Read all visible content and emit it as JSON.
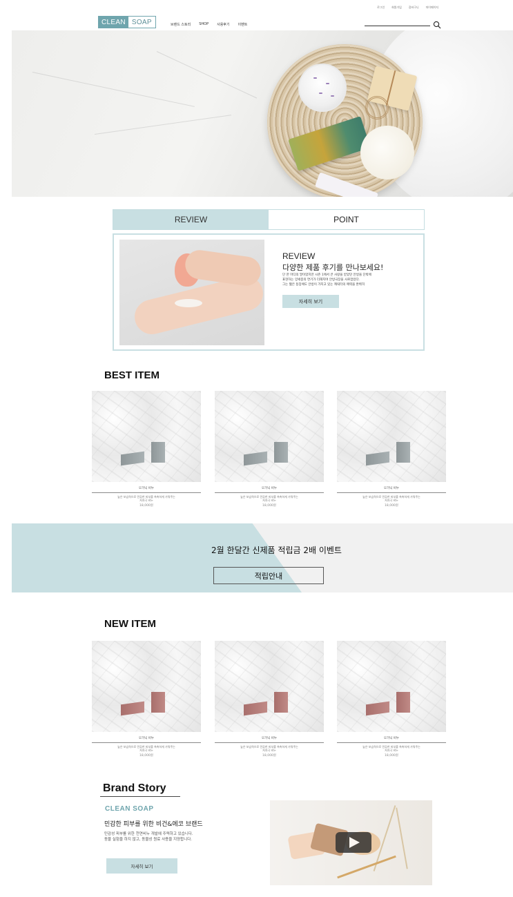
{
  "util_links": [
    "로그인",
    "회원가입",
    "장바구니",
    "마이페이지"
  ],
  "logo": {
    "part1": "CLEAN",
    "part2": "SOAP"
  },
  "nav": [
    "브랜드 스토리",
    "SHOP",
    "사용후기",
    "이벤트"
  ],
  "tabs": {
    "review": "REVIEW",
    "point": "POINT"
  },
  "review": {
    "title": "REVIEW",
    "subtitle": "다양한 제품 후기를 만나보세요!",
    "desc_lines": [
      "단 한 마디의 말이었지만 시즌 1에서 큰 사랑을 받았던 안방을 단박에",
      "표현하는 양세종의 연기가 더해지며 안방극장을 사로잡았다.",
      "그는 짧은 등장에도 안방이 가지고 있는 캐릭터의 매력을 완벽히"
    ],
    "button": "자세히 보기"
  },
  "best": {
    "title": "BEST ITEM",
    "items": [
      {
        "name": "오가닉 비누",
        "desc1": "높은 보습력으로 민감한 피부를 촉촉하게 가꿔주는",
        "desc2": "저자극 비누",
        "price": "18,000원"
      },
      {
        "name": "오가닉 비누",
        "desc1": "높은 보습력으로 민감한 피부를 촉촉하게 가꿔주는",
        "desc2": "저자극 비누",
        "price": "18,000원"
      },
      {
        "name": "오가닉 비누",
        "desc1": "높은 보습력으로 민감한 피부를 촉촉하게 가꿔주는",
        "desc2": "저자극 비누",
        "price": "18,000원"
      }
    ]
  },
  "event": {
    "title": "2월 한달간 신제품 적립금 2배 이벤트",
    "button": "적립안내"
  },
  "new": {
    "title": "NEW ITEM",
    "items": [
      {
        "name": "오가닉 비누",
        "desc1": "높은 보습력으로 민감한 피부를 촉촉하게 가꿔주는",
        "desc2": "저자극 비누",
        "price": "18,000원"
      },
      {
        "name": "오가닉 비누",
        "desc1": "높은 보습력으로 민감한 피부를 촉촉하게 가꿔주는",
        "desc2": "저자극 비누",
        "price": "18,000원"
      },
      {
        "name": "오가닉 비누",
        "desc1": "높은 보습력으로 민감한 피부를 촉촉하게 가꿔주는",
        "desc2": "저자극 비누",
        "price": "18,000원"
      }
    ]
  },
  "brand": {
    "title": "Brand Story",
    "logo": "CLEAN  SOAP",
    "subtitle": "민감한 피부를 위한 비건&에코 브랜드",
    "desc_lines": [
      "민감성 피부를 위한 천연비누 개발에 주력하고 있습니다.",
      "동물 실험을 하지 않고, 동물성 원료 사용을 지양합니다."
    ],
    "button": "자세히 보기"
  },
  "colors": {
    "accent": "#c8dfe2",
    "logo": "#6fa5ad"
  }
}
